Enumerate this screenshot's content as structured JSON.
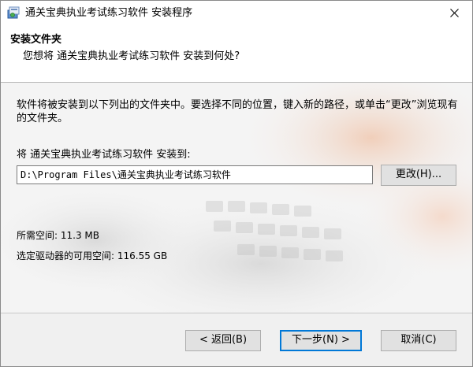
{
  "window": {
    "title": "通关宝典执业考试练习软件 安装程序"
  },
  "header": {
    "title": "安装文件夹",
    "subtitle": "您想将 通关宝典执业考试练习软件 安装到何处?"
  },
  "content": {
    "description": "软件将被安装到以下列出的文件夹中。要选择不同的位置，键入新的路径，或单击“更改”浏览现有的文件夹。",
    "destination_label": "将 通关宝典执业考试练习软件 安装到:",
    "install_path": "D:\\Program Files\\通关宝典执业考试练习软件",
    "change_button": "更改(H)...",
    "space_required": "所需空间: 11.3 MB",
    "space_available": "选定驱动器的可用空间: 116.55 GB"
  },
  "footer": {
    "back_button": "< 返回(B)",
    "next_button": "下一步(N) >",
    "cancel_button": "取消(C)"
  },
  "colors": {
    "title_bg": "#ffffff",
    "dialog_bg": "#f0f0f0",
    "default_button_border": "#0078d7"
  },
  "icons": {
    "app": "installer-app-icon",
    "close": "close-icon"
  }
}
